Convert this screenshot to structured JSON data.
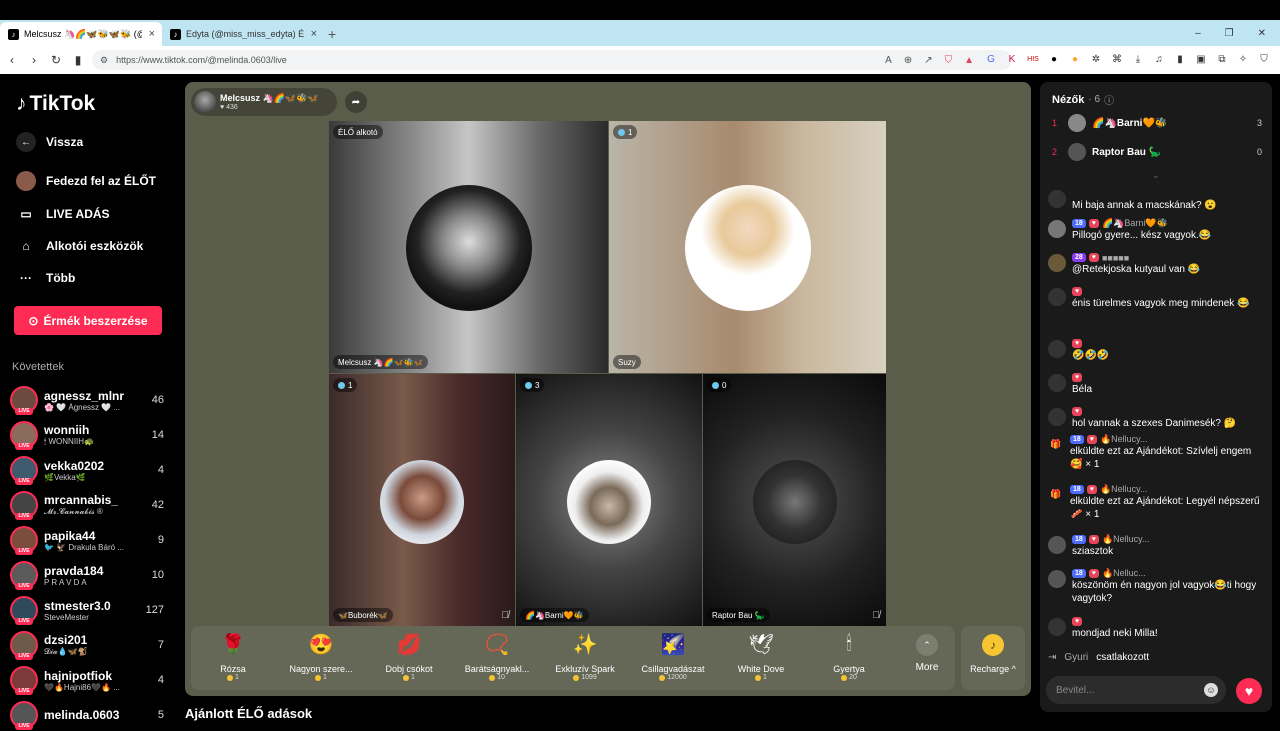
{
  "browser": {
    "tabs": [
      {
        "title": "Melcsusz 🦄🌈🦋🐝🦋🐝 (@",
        "close": "×"
      },
      {
        "title": "Edyta (@miss_miss_edyta) ÉLŐ a",
        "close": "×"
      }
    ],
    "new_tab": "+",
    "url": "https://www.tiktok.com/@melinda.0603/live",
    "win_min": "–",
    "win_max": "❐",
    "win_close": "✕"
  },
  "sidebar": {
    "logo": "TikTok",
    "back": "Vissza",
    "nav": [
      {
        "label": "Fedezd fel az ÉLŐT"
      },
      {
        "label": "LIVE ADÁS"
      },
      {
        "label": "Alkotói eszközök"
      },
      {
        "label": "Több"
      }
    ],
    "coin_button": "Érmék beszerzése",
    "following_header": "Követettek",
    "following": [
      {
        "name": "agnessz_mlnr",
        "sub": "🌸 🤍 Ágnessz 🤍 ...",
        "count": "46",
        "color": "#6d4a3e"
      },
      {
        "name": "wonniih",
        "sub": "🕯 WONNIIH🐢",
        "count": "14",
        "color": "#8a6b5c"
      },
      {
        "name": "vekka0202",
        "sub": "🌿Vekka🌿",
        "count": "4",
        "color": "#3e5a6d"
      },
      {
        "name": "mrcannabis_",
        "sub": "𝓜𝓻.𝓒𝓪𝓷𝓷𝓪𝓫𝓲𝓼 ®",
        "count": "42",
        "color": "#444"
      },
      {
        "name": "papika44",
        "sub": "🐦 🦅 Drakula Báró ...",
        "count": "9",
        "color": "#7a4e3a"
      },
      {
        "name": "pravda184",
        "sub": "P R A V D A",
        "count": "10",
        "color": "#5a5a5a"
      },
      {
        "name": "stmester3.0",
        "sub": "SteveMester",
        "count": "127",
        "color": "#2f4a5a"
      },
      {
        "name": "dzsi201",
        "sub": "𝓓𝓲𝓪💧🦋🐒",
        "count": "7",
        "color": "#6e5a48"
      },
      {
        "name": "hajnipotfiok",
        "sub": "🖤🔥Hajni86🖤🔥 ...",
        "count": "4",
        "color": "#7b3b3b"
      },
      {
        "name": "melinda.0603",
        "sub": "",
        "count": "5",
        "color": "#555"
      }
    ]
  },
  "stage": {
    "host_name": "Melcsusz 🦄🌈🦋🐝🦋",
    "host_likes": "♥ 436",
    "tiles": [
      {
        "tag": "ÉLŐ alkotó",
        "name": "Melcsusz 🦄🌈🦋🐝🦋"
      },
      {
        "tag": "1",
        "name": "Suzy"
      },
      {
        "tag": "1",
        "name": "🦋Buborék🦋"
      },
      {
        "tag": "3",
        "name": "🌈🦄Barni🧡🐝"
      },
      {
        "tag": "0",
        "name": "Raptor Bau 🦕"
      }
    ],
    "gifts": [
      {
        "label": "Rózsa",
        "price": "1",
        "icon": "🌹"
      },
      {
        "label": "Nagyon szere...",
        "price": "1",
        "icon": "😍"
      },
      {
        "label": "Dobj csókot",
        "price": "1",
        "icon": "💋"
      },
      {
        "label": "Barátságnyakl...",
        "price": "10",
        "icon": "📿"
      },
      {
        "label": "Exkluzív Spark",
        "price": "1099",
        "icon": "✨"
      },
      {
        "label": "Csillagvadászat",
        "price": "12000",
        "icon": "🌠"
      },
      {
        "label": "White Dove",
        "price": "1",
        "icon": "🕊"
      },
      {
        "label": "Gyertya",
        "price": "20",
        "icon": "🕯"
      }
    ],
    "more": "More",
    "recharge": "Recharge ^",
    "recommended": "Ajánlott ÉLŐ adások"
  },
  "chat": {
    "viewers_title": "Nézők",
    "viewers_count": "· 6",
    "top_viewers": [
      {
        "rank": "1",
        "name": "🌈🦄Barni🧡🐝",
        "score": "3"
      },
      {
        "rank": "2",
        "name": "Raptor Bau 🦕",
        "score": "0"
      }
    ],
    "messages": [
      {
        "head": "",
        "text": "Mi baja annak a macskának? 😮",
        "avatar": "#333",
        "badges": []
      },
      {
        "head": "🌈🦄Barni🧡🐝",
        "text": "Pillogó gyere... kész vagyok.😂",
        "avatar": "#777",
        "badges": [
          "18",
          "♥"
        ]
      },
      {
        "head": "■■■■■",
        "text": "@Retekjoska kutyaul van 😂",
        "avatar": "#6a5a3a",
        "badges": [
          "28",
          "♥"
        ]
      },
      {
        "head": "",
        "text": "énis türelmes vagyok meg mindenek 😂",
        "avatar": "#333",
        "badges": [
          "♥"
        ]
      },
      {
        "head": "",
        "text": "🤣🤣🤣",
        "avatar": "#333",
        "badges": [
          "♥"
        ]
      },
      {
        "head": "",
        "text": "Béla",
        "avatar": "#333",
        "badges": [
          "♥"
        ]
      },
      {
        "head": "",
        "text": "hol vannak a szexes Danimesék? 🤔",
        "avatar": "#333",
        "badges": [
          "♥"
        ]
      },
      {
        "head": "🔥Nellucy...",
        "text": "elküldte ezt az Ajándékot: Szívlelj engem 🥰 × 1",
        "avatar": "gift",
        "badges": [
          "18",
          "♥"
        ]
      },
      {
        "head": "🔥Nellucy...",
        "text": "elküldte ezt az Ajándékot: Legyél népszerű 🥓 × 1",
        "avatar": "gift",
        "badges": [
          "18",
          "♥"
        ]
      },
      {
        "head": "🔥Nellucy...",
        "text": "sziasztok",
        "avatar": "#555",
        "badges": [
          "18",
          "♥"
        ]
      },
      {
        "head": "🔥Nelluc...",
        "text": "köszönöm én nagyon jol vagyok😂ti hogy vagytok?",
        "avatar": "#555",
        "badges": [
          "18",
          "♥"
        ]
      },
      {
        "head": "",
        "text": "mondjad neki Milla!",
        "avatar": "#333",
        "badges": [
          "♥"
        ]
      }
    ],
    "join_name": "Gyuri",
    "join_text": "csatlakozott",
    "input_placeholder": "Bevitel...",
    "emoji": "☺",
    "heart": "♥"
  }
}
